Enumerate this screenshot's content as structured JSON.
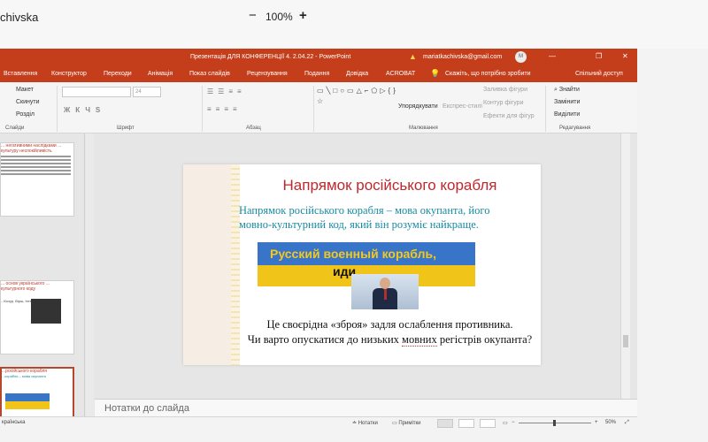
{
  "viewer": {
    "title": "chivska",
    "zoom_minus": "−",
    "zoom": "100%",
    "zoom_plus": "+"
  },
  "titlebar": {
    "doc_title": "Презентація ДЛЯ КОНФЕРЕНЦІЇ 4.    2.04.22  -  PowerPoint",
    "user_email": "mariatkachivska@gmail.com",
    "avatar_initial": "M",
    "minimize": "—",
    "restore": "❐",
    "close": "✕"
  },
  "ribbon_tabs": {
    "insert": "Вставлення",
    "design": "Конструктор",
    "transitions": "Переходи",
    "animation": "Анімація",
    "slideshow": "Показ слайдів",
    "review": "Рецензування",
    "view": "Подання",
    "help": "Довідка",
    "acrobat": "ACROBAT",
    "tell_me": "Скажіть, що потрібно зробити",
    "share": "Спільний доступ"
  },
  "ribbon": {
    "layout": "Макет",
    "reset": "Скинути",
    "section": "Розділ",
    "slides_group": "Слайди",
    "font_group": "Шрифт",
    "font_size": "24",
    "font_format_buttons": "ЖКЧS",
    "paragraph_group": "Абзац",
    "drawing_group": "Малювання",
    "arrange": "Упорядкувати",
    "quick_styles": "Експрес-стилі",
    "shape_fill": "Заливка фігури",
    "shape_outline": "Контур фігури",
    "shape_effects": "Ефекти для фігур",
    "find": "Знайти",
    "replace": "Замінити",
    "select": "Виділити",
    "editing_group": "Редагування"
  },
  "thumbnails": [
    {
      "title": "... негативними наслідками ... культуру неспокійливість",
      "active": false
    },
    {
      "title": "... основ українського ... культурного коду",
      "caption": "...Кочур, Вірш, Інтерв'ю",
      "active": false
    },
    {
      "title": "...російського корабля",
      "caption": "...корабля – мова окупанта",
      "active": true
    }
  ],
  "slide": {
    "title": "Напрямок російського корабля",
    "body_line1": "Напрямок російського корабля – мова окупанта, його",
    "body_line2": "мовно-культурний код, який він розуміє найкраще.",
    "banner_text_1": "Русский военный корабль,",
    "banner_text_2": "иди",
    "line1": "Це своєрідна «зброя» задля ослаблення противника.",
    "line2_pre": "Чи варто опускатися до низьких ",
    "line2_underlined": "мовних",
    "line2_post": " регістрів окупанта?"
  },
  "notes": {
    "placeholder": "Нотатки до слайда"
  },
  "statusbar": {
    "language": "країнська",
    "notes": "Нотатки",
    "comments": "Примітки",
    "zoom_out": "−",
    "zoom_in": "+",
    "zoom": "50%"
  }
}
